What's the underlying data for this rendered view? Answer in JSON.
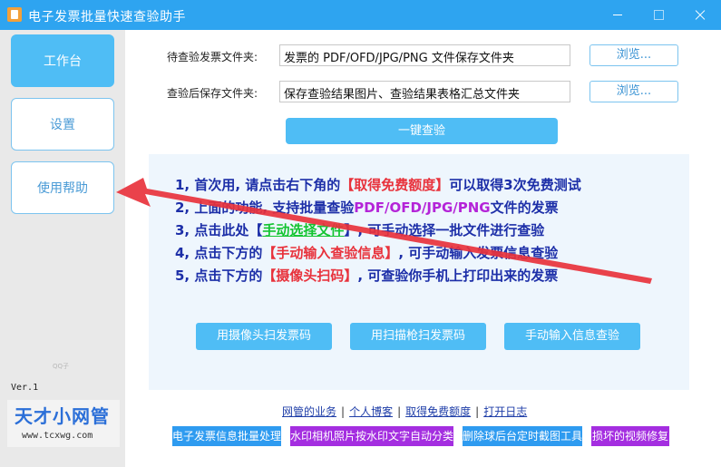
{
  "window": {
    "title": "电子发票批量快速查验助手"
  },
  "sidebar": {
    "items": [
      {
        "label": "工作台"
      },
      {
        "label": "设置"
      },
      {
        "label": "使用帮助"
      }
    ],
    "qq_note": "QQ子",
    "version": "Ver.1",
    "logo": {
      "text": "天才小网管",
      "url": "www.tcxwg.com"
    }
  },
  "fields": {
    "input_folder": {
      "label": "待查验发票文件夹:",
      "value": "发票的 PDF/OFD/JPG/PNG 文件保存文件夹"
    },
    "output_folder": {
      "label": "查验后保存文件夹:",
      "value": "保存查验结果图片、查验结果表格汇总文件夹"
    },
    "browse_label": "浏览..."
  },
  "check_button": "一键查验",
  "help_lines": [
    {
      "parts": [
        {
          "t": "1, 首次用, 请点击右下角的"
        },
        {
          "t": "【取得免费额度】",
          "c": "red"
        },
        {
          "t": "可以取得3次免费测试"
        }
      ]
    },
    {
      "parts": [
        {
          "t": "2, 上面的功能, 支持批量查验"
        },
        {
          "t": "PDF/OFD/JPG/PNG",
          "c": "purple"
        },
        {
          "t": "文件的发票"
        }
      ]
    },
    {
      "parts": [
        {
          "t": "3, 点击此处"
        },
        {
          "t": "【"
        },
        {
          "t": "手动选择文件",
          "c": "green"
        },
        {
          "t": "】, 可手动选择一批文件进行查验"
        }
      ]
    },
    {
      "parts": [
        {
          "t": "4, 点击下方的"
        },
        {
          "t": "【手动输入查验信息】",
          "c": "red"
        },
        {
          "t": ", 可手动输入发票信息查验"
        }
      ]
    },
    {
      "parts": [
        {
          "t": "5, 点击下方的"
        },
        {
          "t": "【摄像头扫码】",
          "c": "red"
        },
        {
          "t": ", 可查验你手机上打印出来的发票"
        }
      ]
    }
  ],
  "actions": [
    {
      "label": "用摄像头扫发票码"
    },
    {
      "label": "用扫描枪扫发票码"
    },
    {
      "label": "手动输入信息查验"
    }
  ],
  "links": [
    "网管的业务",
    "个人博客",
    "取得免费额度",
    "打开日志"
  ],
  "banners": [
    {
      "label": "电子发票信息批量处理",
      "color": "#2e9bf0"
    },
    {
      "label": "水印相机照片按水印文字自动分类",
      "color": "#a42ee0"
    },
    {
      "label": "删除球后台定时截图工具",
      "color": "#2e9bf0"
    },
    {
      "label": "损坏的视频修复",
      "color": "#a42ee0"
    }
  ],
  "colors": {
    "titlebar": "#2ea4f0",
    "accent": "#4fbdf5",
    "arrow": "#e8323c"
  }
}
